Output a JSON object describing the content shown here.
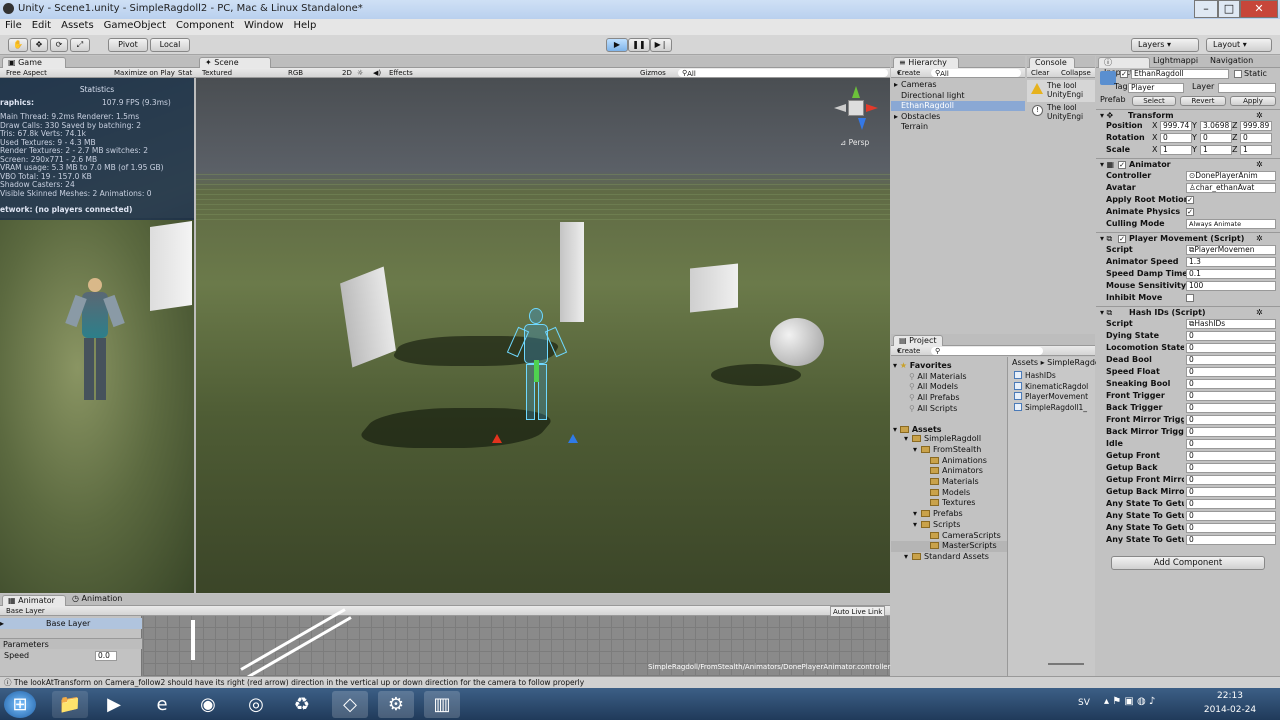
{
  "window": {
    "title": "Unity - Scene1.unity - SimpleRagdoll2 - PC, Mac & Linux Standalone*",
    "min": "–",
    "max": "□",
    "close": "✕"
  },
  "menu": [
    "File",
    "Edit",
    "Assets",
    "GameObject",
    "Component",
    "Window",
    "Help"
  ],
  "toolbar": {
    "pivot": "Pivot",
    "local": "Local",
    "layers": "Layers",
    "layout": "Layout"
  },
  "game": {
    "tab": "Game",
    "aspect": "Free Aspect",
    "maximize": "Maximize on Play",
    "stats_btn": "Stat",
    "stats": {
      "header": "Statistics",
      "graphics_label": "raphics:",
      "fps": "107.9 FPS (9.3ms)",
      "lines": [
        "Main Thread: 9.2ms  Renderer: 1.5ms",
        "Draw Calls: 330   Saved by batching: 2",
        "Tris: 67.8k   Verts: 74.1k",
        "Used Textures: 9 - 4.3 MB",
        "Render Textures: 2 - 2.7 MB  switches: 2",
        "Screen: 290x771 - 2.6 MB",
        "VRAM usage: 5.3 MB to 7.0 MB (of 1.95 GB)",
        "VBO Total: 19 - 157.0 KB",
        "Shadow Casters: 24",
        "Visible Skinned Meshes: 2      Animations: 0"
      ],
      "network": "etwork: (no players connected)"
    }
  },
  "scene": {
    "tab": "Scene",
    "shading": "Textured",
    "rgb": "RGB",
    "mode2d": "2D",
    "effects": "Effects",
    "gizmos": "Gizmos",
    "search": "All",
    "persp": "Persp"
  },
  "hierarchy": {
    "tab": "Hierarchy",
    "create": "Create",
    "search": "All",
    "items": [
      "Cameras",
      "Directional light",
      "EthanRagdoll",
      "Obstacles",
      "Terrain"
    ],
    "selected": "EthanRagdoll"
  },
  "console": {
    "tab": "Console",
    "clear": "Clear",
    "collapse": "Collapse",
    "msgs": [
      {
        "l1": "The lool",
        "l2": "UnityEngi"
      },
      {
        "l1": "The lool",
        "l2": "UnityEngi"
      }
    ]
  },
  "inspector": {
    "tabs": [
      "Inspector",
      "Lightmappi",
      "Navigation"
    ],
    "object": "EthanRagdoll",
    "static": "Static",
    "tag_label": "Tag",
    "tag": "Player",
    "layer_label": "Layer",
    "prefab": "Prefab",
    "select": "Select",
    "revert": "Revert",
    "apply": "Apply",
    "transform": {
      "name": "Transform",
      "rows": [
        {
          "label": "Position",
          "x": "999.74",
          "y": "3.0698",
          "z": "999.89"
        },
        {
          "label": "Rotation",
          "x": "0",
          "y": "0",
          "z": "0"
        },
        {
          "label": "Scale",
          "x": "1",
          "y": "1",
          "z": "1"
        }
      ]
    },
    "animator": {
      "name": "Animator",
      "controller_label": "Controller",
      "controller": "DonePlayerAnim",
      "avatar_label": "Avatar",
      "avatar": "char_ethanAvat",
      "root_motion": "Apply Root Motion",
      "animate_physics": "Animate Physics",
      "culling_label": "Culling Mode",
      "culling": "Always Animate"
    },
    "player_movement": {
      "name": "Player Movement (Script)",
      "script_label": "Script",
      "script": "PlayerMovemen",
      "rows": [
        {
          "label": "Animator Speed",
          "value": "1.3"
        },
        {
          "label": "Speed Damp Time",
          "value": "0.1"
        },
        {
          "label": "Mouse Sensitivity",
          "value": "100"
        }
      ],
      "inhibit": "Inhibit Move"
    },
    "hash_ids": {
      "name": "Hash IDs (Script)",
      "script_label": "Script",
      "script": "HashIDs",
      "rows": [
        "Dying State",
        "Locomotion State",
        "Dead Bool",
        "Speed Float",
        "Sneaking Bool",
        "Front Trigger",
        "Back Trigger",
        "Front Mirror Trigg",
        "Back Mirror Trigge",
        "Idle",
        "Getup Front",
        "Getup Back",
        "Getup Front Mirro",
        "Getup Back Mirror",
        "Any State To Getu",
        "Any State To Getu",
        "Any State To Getu",
        "Any State To Getu"
      ],
      "value": "0"
    },
    "add_component": "Add Component"
  },
  "project": {
    "tab": "Project",
    "create": "Create",
    "favorites": "Favorites",
    "fav_items": [
      "All Materials",
      "All Models",
      "All Prefabs",
      "All Scripts"
    ],
    "assets": "Assets",
    "tree": [
      {
        "n": "SimpleRagdoll",
        "d": 1
      },
      {
        "n": "FromStealth",
        "d": 2
      },
      {
        "n": "Animations",
        "d": 3
      },
      {
        "n": "Animators",
        "d": 3
      },
      {
        "n": "Materials",
        "d": 3
      },
      {
        "n": "Models",
        "d": 3
      },
      {
        "n": "Textures",
        "d": 3
      },
      {
        "n": "Prefabs",
        "d": 2
      },
      {
        "n": "Scripts",
        "d": 2
      },
      {
        "n": "CameraScripts",
        "d": 3
      },
      {
        "n": "MasterScripts",
        "d": 3
      },
      {
        "n": "Standard Assets",
        "d": 1
      }
    ],
    "selected": "MasterScripts",
    "breadcrumb": "Assets ▸ SimpleRagdo",
    "files": [
      "HashIDs",
      "KinematicRagdol",
      "PlayerMovement",
      "SimpleRagdoll1_"
    ]
  },
  "animator_win": {
    "tab": "Animator",
    "tab2": "Animation",
    "base_layer": "Base Layer",
    "layer_item": "Base Layer",
    "parameters": "Parameters",
    "param": "Speed",
    "param_value": "0.0",
    "auto_live": "Auto Live Link",
    "path": "SimpleRagdoll/FromStealth/Animators/DonePlayerAnimator.controller"
  },
  "status": "The lookAtTransform on Camera_follow2 should have its right (red arrow) direction in the vertical up or down direction for the camera to follow properly",
  "taskbar": {
    "lang": "SV",
    "time": "22:13",
    "date": "2014-02-24"
  }
}
